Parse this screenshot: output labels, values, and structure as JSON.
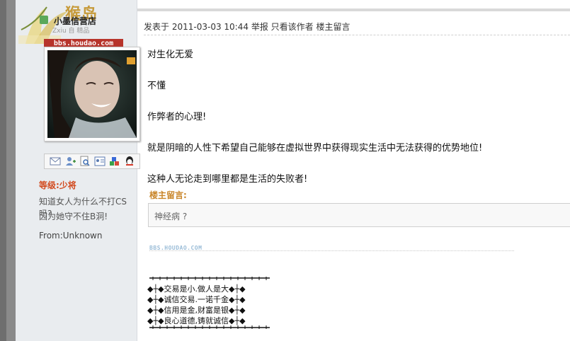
{
  "profile": {
    "username": "小墨信营店",
    "username_sub": "Zxiu 自 精品",
    "watermark_logo_text": "猴岛",
    "watermark_url": "bbs.houdao.com",
    "rank": "等级:少将",
    "signature_line1": "知道女人为什么不打CS吗?",
    "signature_line2": "因为她守不住B洞!",
    "from": "From:Unknown",
    "icons": [
      "mail-icon",
      "add-friend-icon",
      "search-icon",
      "profile-card-icon",
      "blocks-icon",
      "qq-icon"
    ]
  },
  "post": {
    "meta": {
      "posted_label": "发表于",
      "timestamp": "2011-03-03 10:44",
      "report": "举报",
      "only_author": "只看该作者",
      "owner_reply": "楼主留言"
    },
    "lines": [
      "对生化无爱",
      "不懂",
      "作弊者的心理!",
      "就是阴暗的人性下希望自己能够在虚拟世界中获得现实生活中无法获得的优势地位!",
      "这种人无论走到哪里都是生活的失败者!"
    ],
    "owner_reply_label": "楼主留言:",
    "owner_reply_text": "神经病 ?",
    "watermark_small": "BBS.HOUDAO.COM",
    "signature_block": [
      "◆┼◆交易是小.做人是大◆┼◆",
      "◆┼◆诚信交易.一诺千金◆┼◆",
      "◆┼◆信用是金,财富是银◆┼◆",
      "◆┼◆良心道德,铸就诚信◆┼◆"
    ]
  },
  "colors": {
    "rank": "#d24a1e",
    "owner_label": "#c9862a",
    "profile_bg": "#e9ecef",
    "watermark_badge": "#b7342b"
  }
}
